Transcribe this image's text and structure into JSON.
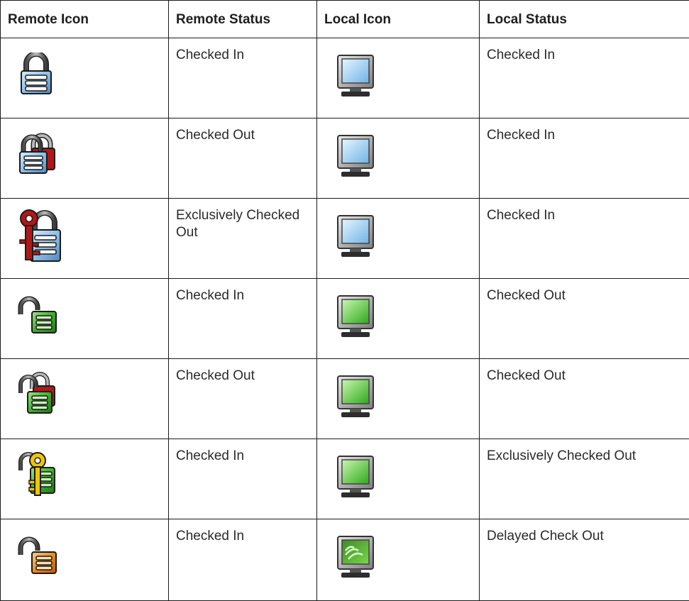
{
  "table": {
    "headers": {
      "remote_icon": "Remote Icon",
      "remote_status": "Remote Status",
      "local_icon": "Local Icon",
      "local_status": "Local Status"
    },
    "rows": [
      {
        "remote_icon": "blue-closed-padlock-icon",
        "remote_status": "Checked In",
        "local_icon": "blue-screen-monitor-icon",
        "local_status": "Checked In"
      },
      {
        "remote_icon": "blue-padlock-red-lock-icon",
        "remote_status": "Checked Out",
        "local_icon": "blue-screen-monitor-icon",
        "local_status": "Checked In"
      },
      {
        "remote_icon": "blue-padlock-red-key-icon",
        "remote_status": "Exclusively Checked Out",
        "local_icon": "blue-screen-monitor-icon",
        "local_status": "Checked In"
      },
      {
        "remote_icon": "green-open-padlock-icon",
        "remote_status": "Checked In",
        "local_icon": "green-screen-monitor-icon",
        "local_status": "Checked Out"
      },
      {
        "remote_icon": "green-padlock-red-lock-icon",
        "remote_status": "Checked Out",
        "local_icon": "green-screen-monitor-icon",
        "local_status": "Checked Out"
      },
      {
        "remote_icon": "green-padlock-yellow-key-icon",
        "remote_status": "Checked In",
        "local_icon": "green-screen-monitor-icon",
        "local_status": "Exclusively Checked Out"
      },
      {
        "remote_icon": "orange-open-padlock-icon",
        "remote_status": "Checked In",
        "local_icon": "green-wave-monitor-icon",
        "local_status": "Delayed Check Out"
      }
    ]
  },
  "colors": {
    "border": "#1a1a1a",
    "lock_blue": "#8fc0ea",
    "lock_green": "#3fae2e",
    "lock_red": "#b01818",
    "lock_orange": "#f08a1c",
    "key_yellow": "#f2c500",
    "screen_blue": "#bfe2fb",
    "screen_green": "#62d63a"
  }
}
